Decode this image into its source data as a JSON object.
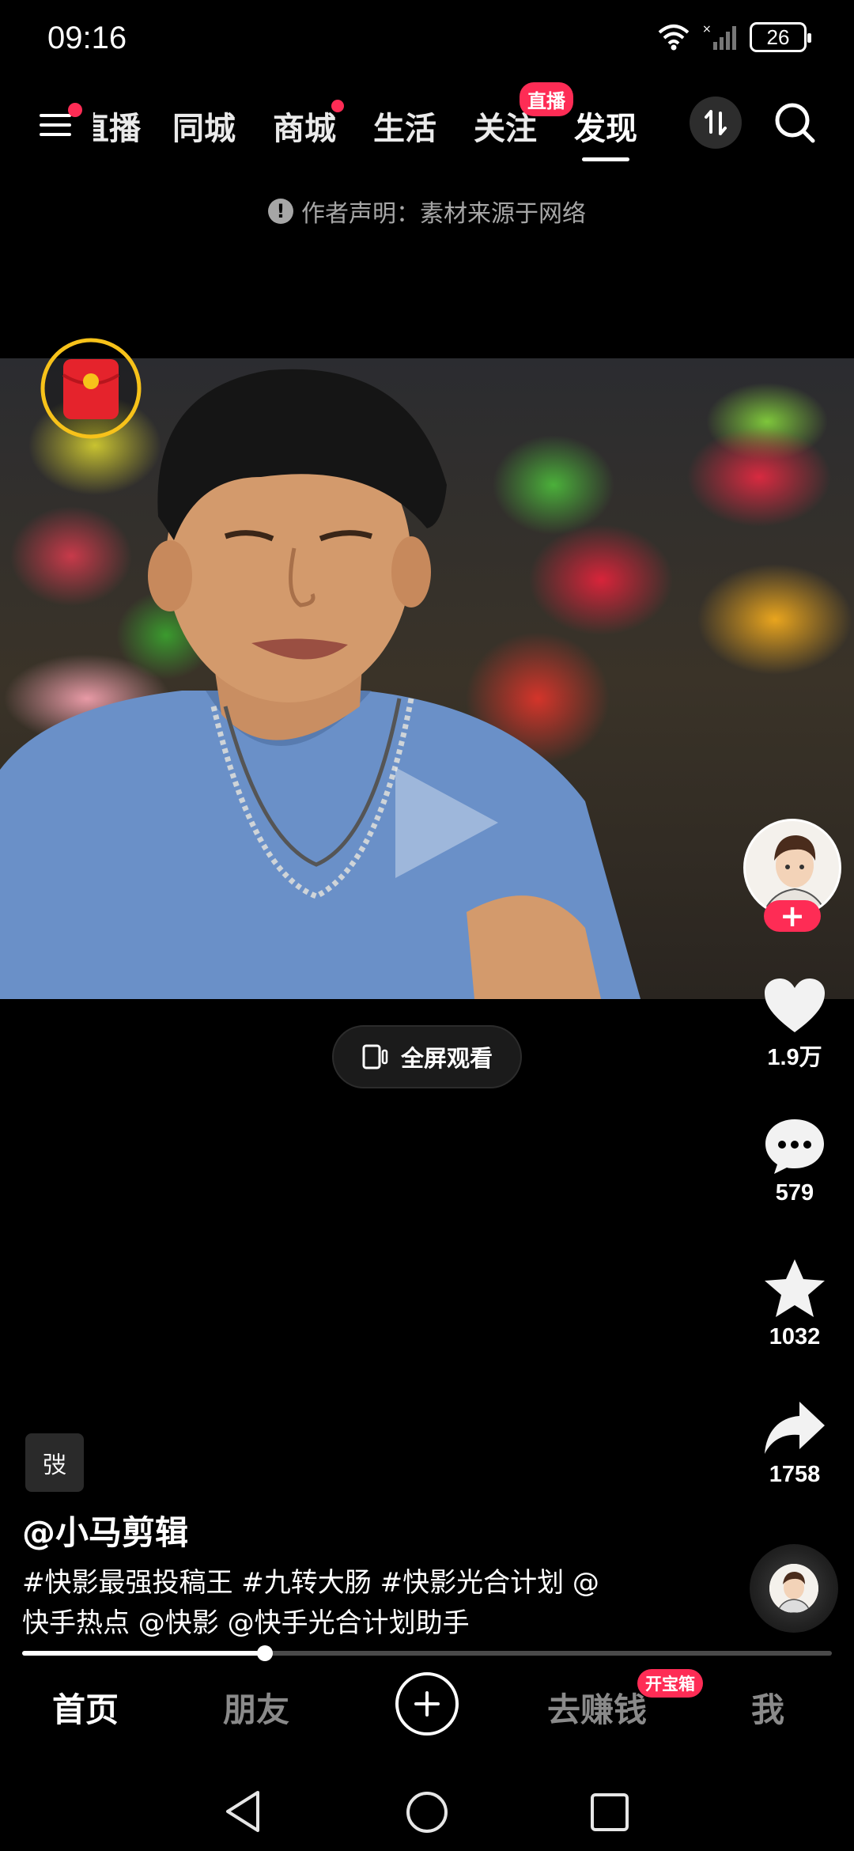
{
  "status_bar": {
    "time": "09:16",
    "battery": "26"
  },
  "top_nav": {
    "tabs": [
      {
        "label": "直播",
        "state": "partial"
      },
      {
        "label": "同城"
      },
      {
        "label": "商城",
        "dot": true
      },
      {
        "label": "生活"
      },
      {
        "label": "关注",
        "badge": "直播"
      },
      {
        "label": "发现",
        "active": true
      }
    ]
  },
  "notice": {
    "text": "作者声明：素材来源于网络"
  },
  "fullscreen": {
    "label": "全屏观看"
  },
  "actions": {
    "likes": "1.9万",
    "comments": "579",
    "favorites": "1032",
    "shares": "1758"
  },
  "post": {
    "tag_chip": "弢",
    "author": "@小马剪辑",
    "description_line1": "#快影最强投稿王 #九转大肠 #快影光合计划 @",
    "description_line2": "快手热点 @快影 @快手光合计划助手",
    "progress": 0.3
  },
  "bottom_nav": {
    "home": "首页",
    "friends": "朋友",
    "earn": "去赚钱",
    "earn_badge": "开宝箱",
    "me": "我"
  },
  "colors": {
    "accent": "#fe2c55",
    "background": "#000000"
  }
}
